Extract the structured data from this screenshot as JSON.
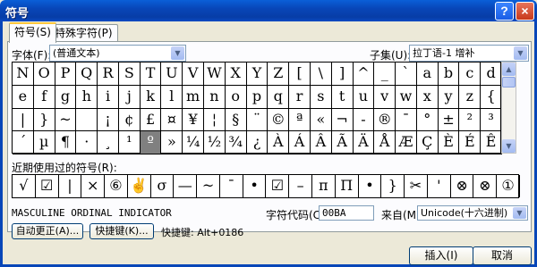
{
  "window": {
    "title": "符号",
    "help": "?",
    "close": "×"
  },
  "tabs": [
    {
      "label": "符号(S)"
    },
    {
      "label": "特殊字符(P)"
    }
  ],
  "font": {
    "label": "字体(F):",
    "value": "(普通文本)"
  },
  "subset": {
    "label": "子集(U):",
    "value": "拉丁语-1 增补"
  },
  "symbols": [
    [
      "N",
      "O",
      "P",
      "Q",
      "R",
      "S",
      "T",
      "U",
      "V",
      "W",
      "X",
      "Y",
      "Z",
      "[",
      "\\",
      "]",
      "^",
      "_",
      "`",
      "a",
      "b",
      "c",
      "d"
    ],
    [
      "e",
      "f",
      "g",
      "h",
      "i",
      "j",
      "k",
      "l",
      "m",
      "n",
      "o",
      "p",
      "q",
      "r",
      "s",
      "t",
      "u",
      "v",
      "w",
      "x",
      "y",
      "z",
      "{"
    ],
    [
      "|",
      "}",
      "~",
      "",
      "¡",
      "¢",
      "£",
      "¤",
      "¥",
      "¦",
      "§",
      "¨",
      "©",
      "ª",
      "«",
      "¬",
      "-",
      "®",
      "¯",
      "°",
      "±",
      "²",
      "³"
    ],
    [
      "´",
      "µ",
      "¶",
      "·",
      "¸",
      "¹",
      "º",
      "»",
      "¼",
      "½",
      "¾",
      "¿",
      "À",
      "Á",
      "Â",
      "Ã",
      "Ä",
      "Å",
      "Æ",
      "Ç",
      "È",
      "É",
      "Ê"
    ]
  ],
  "selected": {
    "row": 3,
    "col": 6
  },
  "recent": {
    "label": "近期使用过的符号(R):",
    "items": [
      "√",
      "☑",
      "|",
      "×",
      "⑥",
      "✌",
      "σ",
      "—",
      "~",
      "¯",
      "•",
      "☑",
      "–",
      "п",
      "Π",
      "•",
      "}",
      "✂",
      "'",
      "⊗",
      "⊗",
      "①"
    ]
  },
  "char_name": "MASCULINE ORDINAL INDICATOR",
  "char_code": {
    "label": "字符代码(C):",
    "value": "00BA"
  },
  "from": {
    "label": "来自(M):",
    "value": "Unicode(十六进制)"
  },
  "autocorrect_button": "自动更正(A)...",
  "shortcut_button": "快捷键(K)...",
  "shortcut_text": "快捷键: Alt+0186",
  "insert_button": "插入(I)",
  "cancel_button": "取消",
  "arrows": {
    "down": "▼",
    "up": "▲"
  }
}
